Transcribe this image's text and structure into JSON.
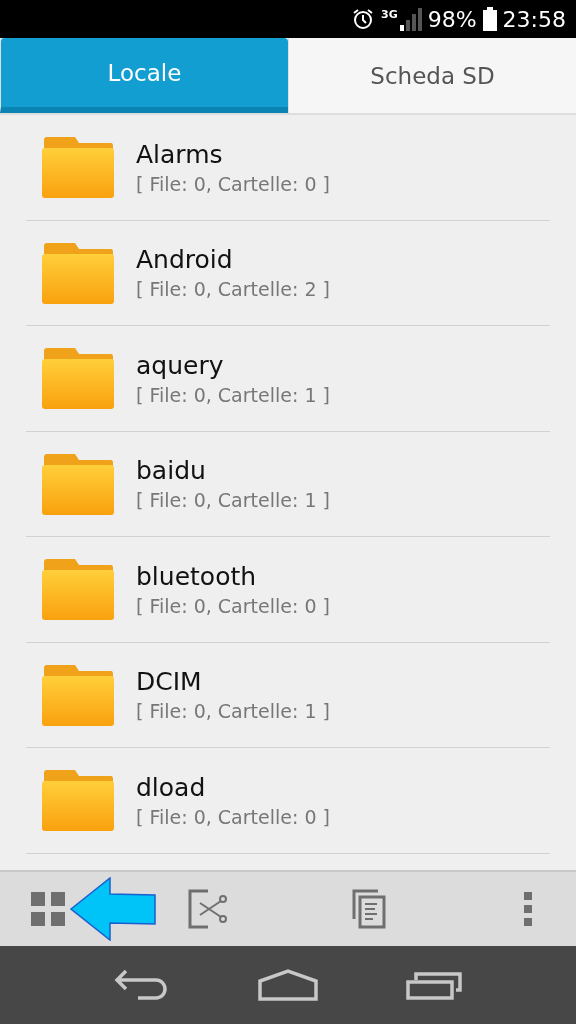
{
  "status_bar": {
    "network": "3G",
    "battery": "98%",
    "time": "23:58"
  },
  "tabs": [
    {
      "label": "Locale",
      "selected": true
    },
    {
      "label": "Scheda SD",
      "selected": false
    }
  ],
  "folders": [
    {
      "name": "Alarms",
      "info": "[ File: 0, Cartelle: 0 ]"
    },
    {
      "name": "Android",
      "info": "[ File: 0, Cartelle: 2 ]"
    },
    {
      "name": "aquery",
      "info": "[ File: 0, Cartelle: 1 ]"
    },
    {
      "name": "baidu",
      "info": "[ File: 0, Cartelle: 1 ]"
    },
    {
      "name": "bluetooth",
      "info": "[ File: 0, Cartelle: 0 ]"
    },
    {
      "name": "DCIM",
      "info": "[ File: 0, Cartelle: 1 ]"
    },
    {
      "name": "dload",
      "info": "[ File: 0, Cartelle: 0 ]"
    }
  ]
}
